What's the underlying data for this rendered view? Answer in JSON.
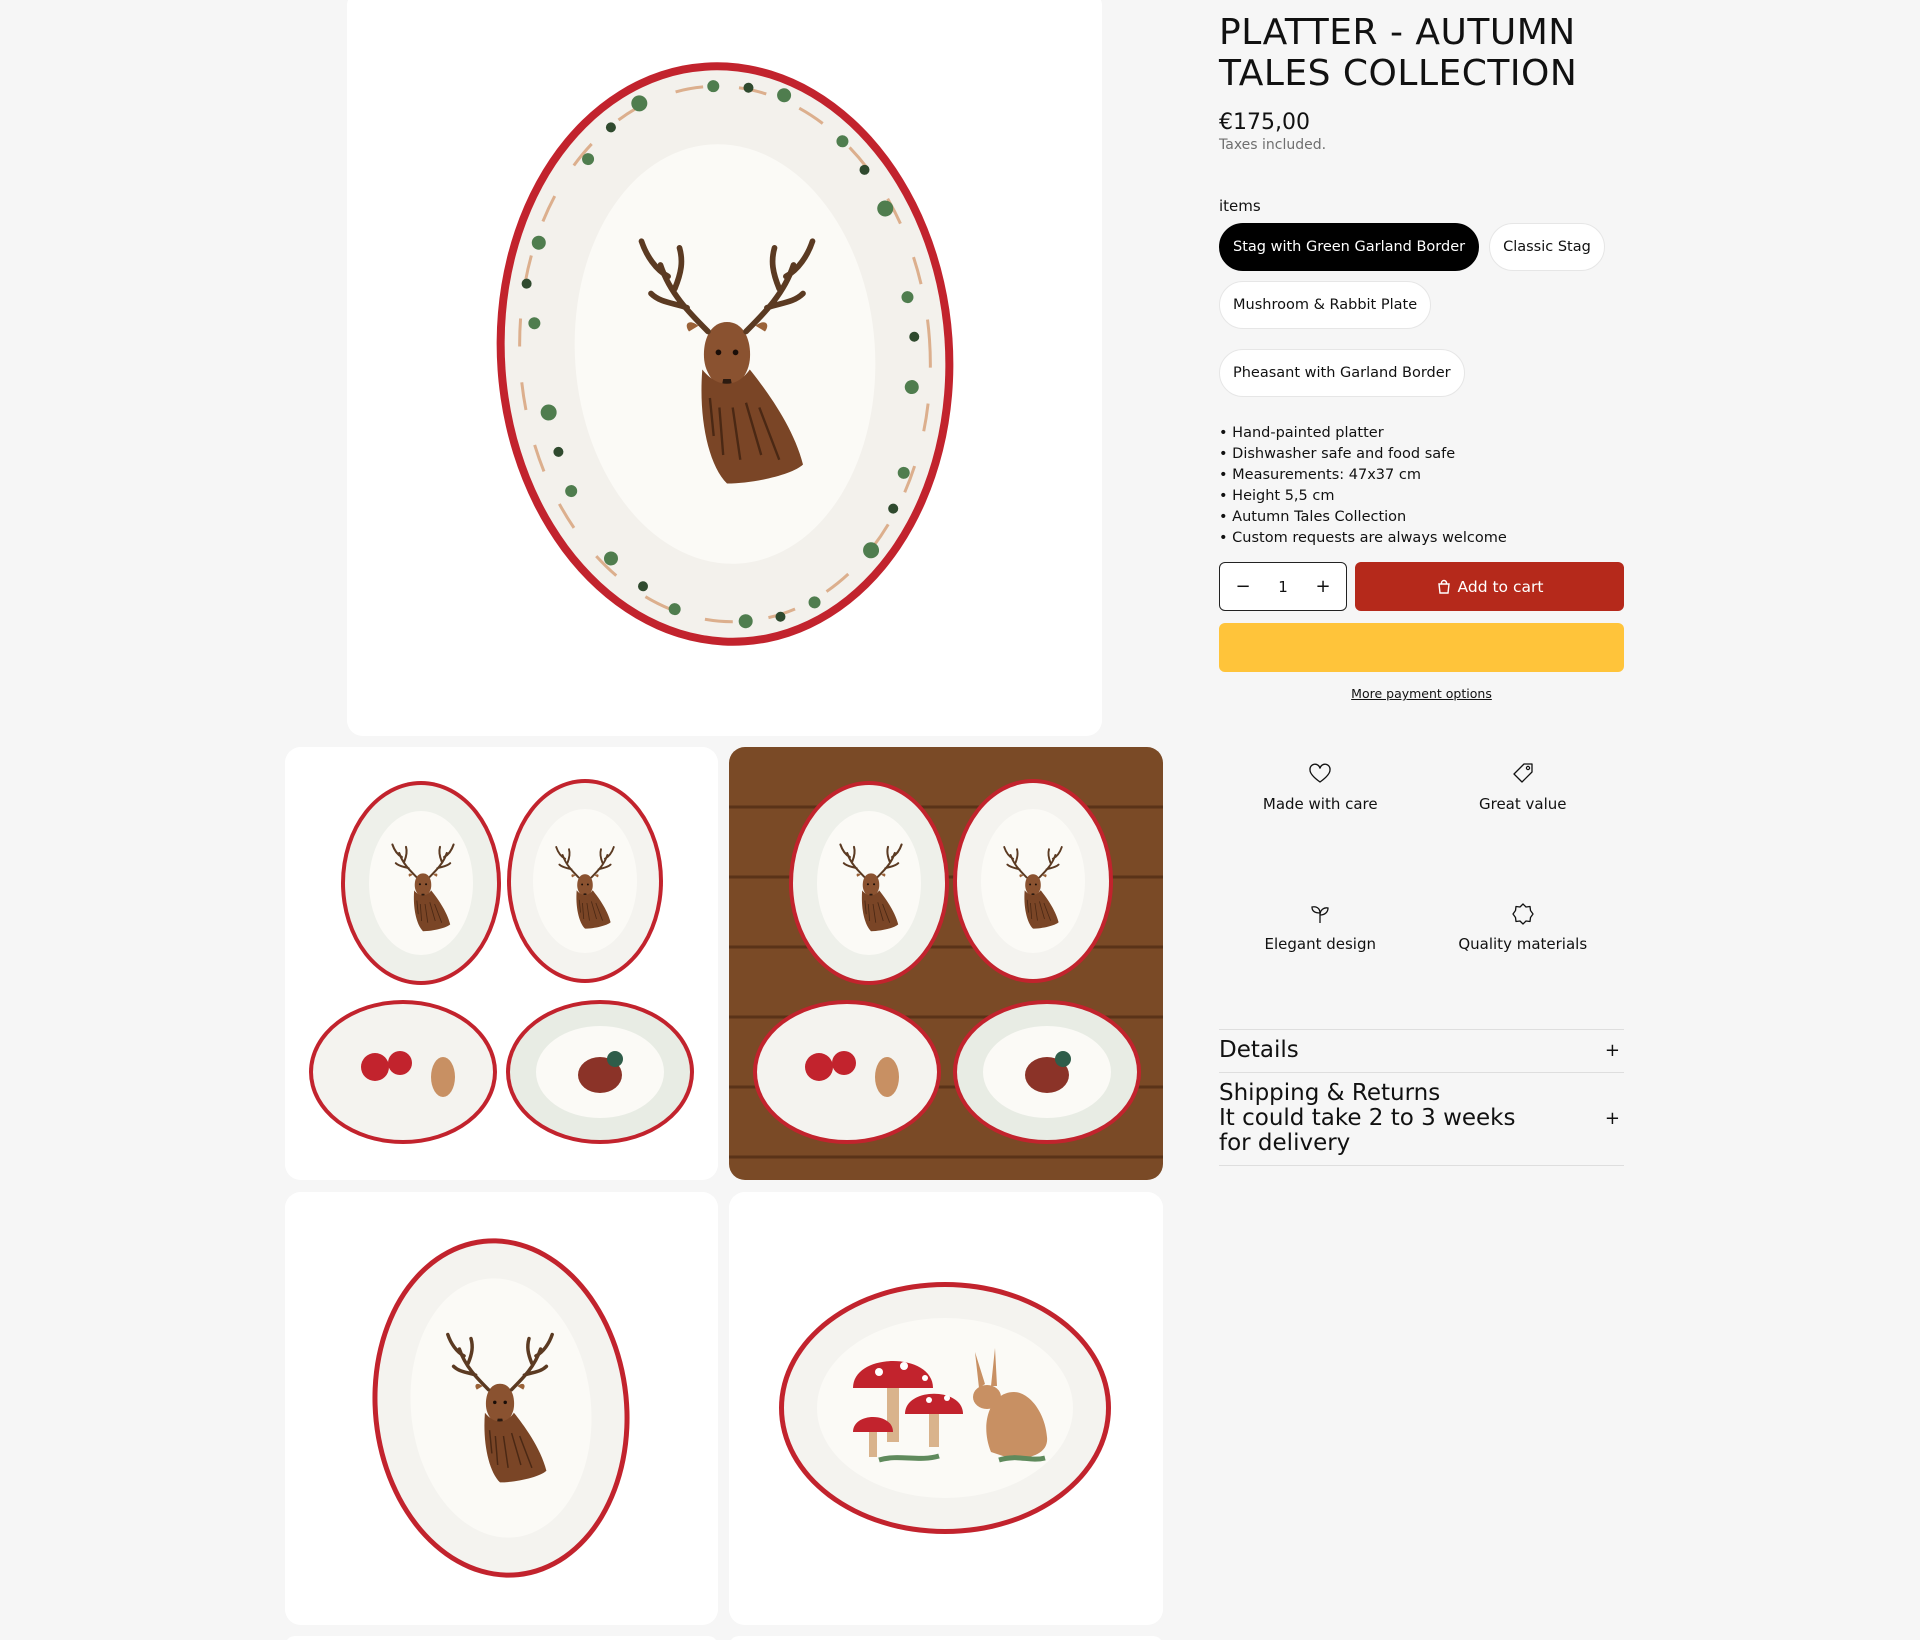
{
  "product": {
    "title": "PLATTER - AUTUMN TALES COLLECTION",
    "price": "€175,00",
    "tax_note": "Taxes included."
  },
  "options": {
    "label": "items",
    "values": [
      "Stag with Green Garland Border",
      "Classic Stag",
      "Mushroom & Rabbit Plate",
      "Pheasant with Garland Border"
    ],
    "selected": "Stag with Green Garland Border"
  },
  "bullets": [
    "• Hand-painted platter",
    "• Dishwasher safe and food safe",
    "• Measurements: 47x37 cm",
    "• Height 5,5 cm",
    "• Autumn Tales Collection",
    "• Custom requests are always welcome"
  ],
  "cart": {
    "quantity": "1",
    "minus": "−",
    "plus": "+",
    "add_label": "Add to cart",
    "more_payment": "More payment options"
  },
  "features": [
    {
      "label": "Made with care",
      "icon": "heart-icon"
    },
    {
      "label": "Great value",
      "icon": "tag-icon"
    },
    {
      "label": "Elegant design",
      "icon": "sprout-icon"
    },
    {
      "label": "Quality materials",
      "icon": "badge-icon"
    }
  ],
  "accordion": [
    {
      "title": "Details",
      "toggle": "+"
    },
    {
      "title": "Shipping & Returns\nIt could take 2 to 3 weeks for delivery",
      "toggle": "+"
    }
  ],
  "colors": {
    "background": "#f6f6f6",
    "add_to_cart": "#b5291b",
    "express_pay": "#ffc43a",
    "selected_pill": "#000000",
    "plate_rim": "#c2232d"
  }
}
